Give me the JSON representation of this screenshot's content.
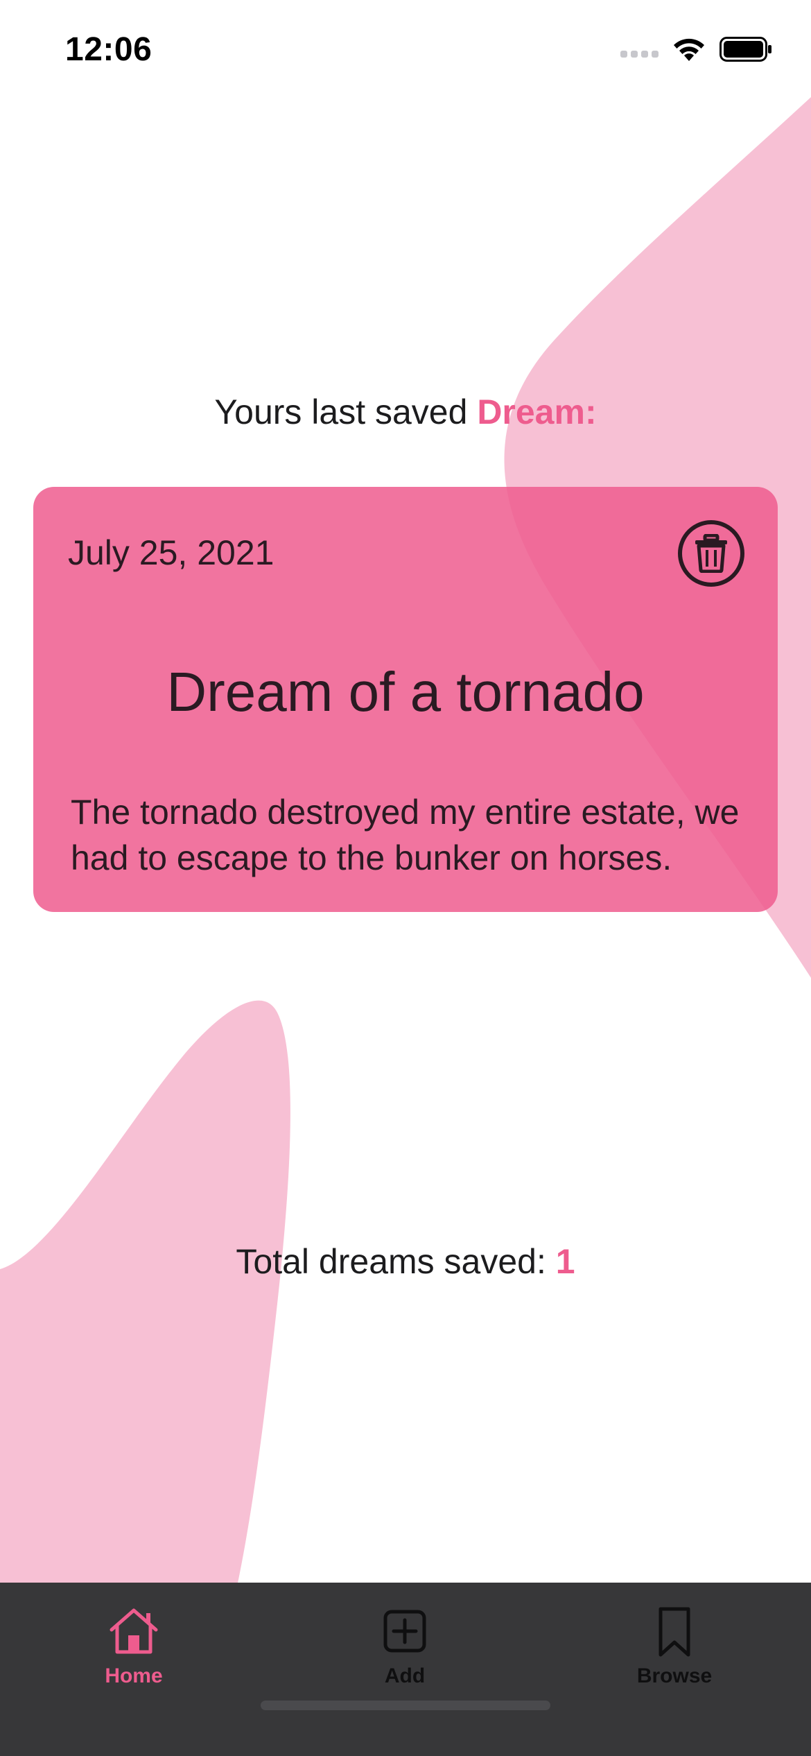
{
  "status_bar": {
    "time": "12:06",
    "icons": [
      "signal-icon",
      "wifi-icon",
      "battery-icon"
    ]
  },
  "heading": {
    "prefix": "Yours last saved ",
    "accent": "Dream:"
  },
  "dream_card": {
    "date": "July 25, 2021",
    "title": "Dream of a tornado",
    "description": "The tornado destroyed my entire estate, we had to escape to the bunker on horses.",
    "delete_icon": "trash-icon"
  },
  "total": {
    "label": "Total dreams saved: ",
    "count": "1"
  },
  "tab_bar": {
    "tabs": [
      {
        "label": "Home",
        "icon": "home-icon",
        "active": true
      },
      {
        "label": "Add",
        "icon": "plus-square-icon",
        "active": false
      },
      {
        "label": "Browse",
        "icon": "bookmark-icon",
        "active": false
      }
    ]
  },
  "colors": {
    "accent": "#ee5c8e",
    "blob": "#f7c0d4",
    "card": "#f06b98",
    "tab_bar_bg": "#373739"
  }
}
